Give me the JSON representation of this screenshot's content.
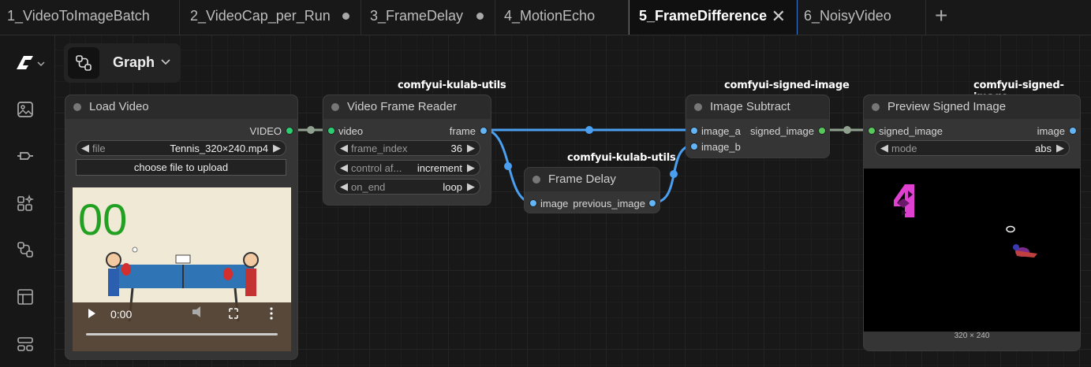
{
  "tabs": [
    {
      "label": "1_VideoToImageBatch",
      "state": "normal"
    },
    {
      "label": "2_VideoCap_per_Run",
      "state": "modified"
    },
    {
      "label": "3_FrameDelay",
      "state": "modified"
    },
    {
      "label": "4_MotionEcho",
      "state": "normal"
    },
    {
      "label": "5_FrameDifference",
      "state": "active"
    },
    {
      "label": "6_NoisyVideo",
      "state": "normal"
    }
  ],
  "tab_close_glyph": "✕",
  "new_tab_glyph": "+",
  "sidebar_icons": [
    "comfy-logo-icon",
    "images-icon",
    "nodes-icon",
    "model-library-icon",
    "workflows-icon",
    "templates-icon",
    "queue-icon"
  ],
  "toolbar": {
    "graph_label": "Graph"
  },
  "colors": {
    "accent_blue": "#4a9ff0",
    "tab_active_border": "#3a78c9",
    "image_slot": "#64b5f6",
    "video_slot": "#2ecc71",
    "signed_slot": "#57c85a"
  },
  "nodes": {
    "load_video": {
      "title": "Load Video",
      "output": "VIDEO",
      "file_name": "file",
      "file_value": "Tennis_320×240.mp4",
      "upload_label": "choose file to upload",
      "counter": "00",
      "time": "0:00"
    },
    "video_frame_reader": {
      "badge": "comfyui-kulab-utils",
      "title": "Video Frame Reader",
      "input": "video",
      "output": "frame",
      "widgets": [
        {
          "name": "frame_index",
          "value": "36"
        },
        {
          "name": "control af...",
          "value": "increment"
        },
        {
          "name": "on_end",
          "value": "loop"
        }
      ]
    },
    "frame_delay": {
      "badge": "comfyui-kulab-utils",
      "title": "Frame Delay",
      "input": "image",
      "output": "previous_image"
    },
    "image_subtract": {
      "badge": "comfyui-signed-image",
      "title": "Image Subtract",
      "inputs": [
        "image_a",
        "image_b"
      ],
      "output": "signed_image"
    },
    "preview_signed_image": {
      "badge": "comfyui-signed-image",
      "title": "Preview Signed Image",
      "input": "signed_image",
      "output": "image",
      "mode_name": "mode",
      "mode_value": "abs",
      "size_label": "320 × 240"
    }
  }
}
